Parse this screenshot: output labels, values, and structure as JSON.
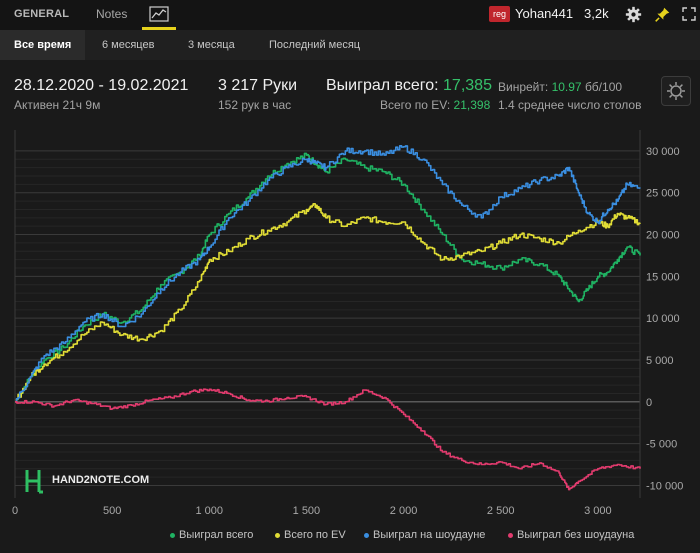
{
  "header": {
    "tabs": [
      {
        "label": "GENERAL"
      },
      {
        "label": "Notes"
      }
    ],
    "user": {
      "badge": "reg",
      "name": "Yohan441",
      "balance": "3,2k"
    },
    "accent": "#e6d21c"
  },
  "periods": [
    {
      "label": "Все время",
      "active": true
    },
    {
      "label": "6 месяцев"
    },
    {
      "label": "3 месяца"
    },
    {
      "label": "Последний месяц"
    }
  ],
  "stats": {
    "date_range": "28.12.2020 - 19.02.2021",
    "active": "Активен 21ч 9м",
    "hands": "3 217 Руки",
    "hands_rate": "152 рук в час",
    "won_total_label": "Выиграл всего:",
    "won_total_value": "17,385",
    "ev_label": "Всего по EV:",
    "ev_value": "21,398",
    "winrate_label": "Винрейт:",
    "winrate_value": "10.97",
    "winrate_unit": "бб/100",
    "tables": "1.4 среднее число столов"
  },
  "watermark": "HAND2NOTE.COM",
  "chart_data": {
    "type": "line",
    "x_ticks": [
      0,
      500,
      1000,
      1500,
      2000,
      2500,
      3000
    ],
    "x_tick_labels": [
      "0",
      "500",
      "1 000",
      "1 500",
      "2 000",
      "2 500",
      "3 000"
    ],
    "y_ticks": [
      -10000,
      -5000,
      0,
      5000,
      10000,
      15000,
      20000,
      25000,
      30000
    ],
    "y_tick_labels": [
      "-10 000",
      "-5 000",
      "0",
      "5 000",
      "10 000",
      "15 000",
      "20 000",
      "25 000",
      "30 000"
    ],
    "xlim": [
      0,
      3217
    ],
    "ylim": [
      -11500,
      32500
    ],
    "grid": true,
    "legend_position": "bottom",
    "series": [
      {
        "name": "Выиграл всего",
        "color": "#1fb262",
        "x": [
          0,
          80,
          150,
          250,
          350,
          450,
          550,
          650,
          750,
          850,
          950,
          1000,
          1100,
          1200,
          1300,
          1400,
          1500,
          1550,
          1600,
          1700,
          1800,
          1900,
          2000,
          2100,
          2200,
          2300,
          2400,
          2500,
          2600,
          2700,
          2800,
          2850,
          2900,
          2950,
          3000,
          3050,
          3100,
          3150,
          3217
        ],
        "y": [
          0,
          3000,
          5000,
          6500,
          9000,
          10500,
          9500,
          11000,
          14000,
          15500,
          17500,
          20000,
          22500,
          24500,
          27000,
          28500,
          29500,
          28500,
          27500,
          29000,
          28000,
          27500,
          26000,
          23000,
          20000,
          17000,
          16500,
          16000,
          17000,
          16500,
          15000,
          13500,
          12000,
          13500,
          15000,
          15500,
          17000,
          18500,
          17500
        ]
      },
      {
        "name": "Всего по EV",
        "color": "#e0dc35",
        "x": [
          0,
          80,
          150,
          250,
          350,
          450,
          550,
          650,
          750,
          850,
          950,
          1000,
          1100,
          1200,
          1300,
          1400,
          1500,
          1550,
          1600,
          1700,
          1800,
          1900,
          2000,
          2100,
          2200,
          2300,
          2400,
          2500,
          2600,
          2700,
          2800,
          2900,
          3000,
          3050,
          3100,
          3150,
          3217
        ],
        "y": [
          0,
          3000,
          4500,
          6000,
          8000,
          9500,
          8000,
          7500,
          8500,
          11000,
          14500,
          17000,
          18000,
          19500,
          20500,
          21500,
          23000,
          23500,
          22000,
          21000,
          22000,
          21500,
          21500,
          19000,
          17000,
          17500,
          18000,
          19000,
          20000,
          19500,
          19000,
          20500,
          21500,
          21000,
          22500,
          22000,
          21400
        ]
      },
      {
        "name": "Выиграл на шоудауне",
        "color": "#3a8ee0",
        "x": [
          0,
          80,
          150,
          250,
          350,
          450,
          550,
          650,
          750,
          850,
          950,
          1000,
          1100,
          1200,
          1300,
          1400,
          1500,
          1550,
          1600,
          1700,
          1800,
          1900,
          2000,
          2100,
          2200,
          2300,
          2400,
          2500,
          2600,
          2700,
          2800,
          2850,
          2900,
          2950,
          3000,
          3050,
          3100,
          3150,
          3217
        ],
        "y": [
          0,
          3000,
          5500,
          7000,
          9500,
          10500,
          9000,
          10500,
          13500,
          15500,
          17000,
          18500,
          22000,
          24000,
          26500,
          28000,
          29000,
          28500,
          28000,
          30000,
          30000,
          29500,
          30500,
          29000,
          26000,
          23500,
          22000,
          24500,
          25500,
          26500,
          27000,
          28000,
          25000,
          22500,
          21500,
          23000,
          24000,
          26000,
          25500
        ]
      },
      {
        "name": "Выиграл без шоудауна",
        "color": "#e23b6e",
        "x": [
          0,
          100,
          200,
          300,
          400,
          500,
          600,
          700,
          800,
          900,
          1000,
          1100,
          1200,
          1300,
          1400,
          1500,
          1600,
          1700,
          1800,
          1900,
          2000,
          2100,
          2200,
          2300,
          2400,
          2500,
          2600,
          2700,
          2800,
          2850,
          2900,
          3000,
          3100,
          3217
        ],
        "y": [
          0,
          0,
          -500,
          200,
          -200,
          -800,
          -400,
          200,
          500,
          1200,
          1500,
          1000,
          200,
          100,
          500,
          600,
          -300,
          0,
          1400,
          500,
          -1500,
          -3500,
          -6000,
          -7000,
          -7500,
          -7200,
          -8000,
          -7300,
          -8500,
          -10500,
          -9500,
          -8000,
          -7500,
          -8000
        ]
      }
    ]
  }
}
